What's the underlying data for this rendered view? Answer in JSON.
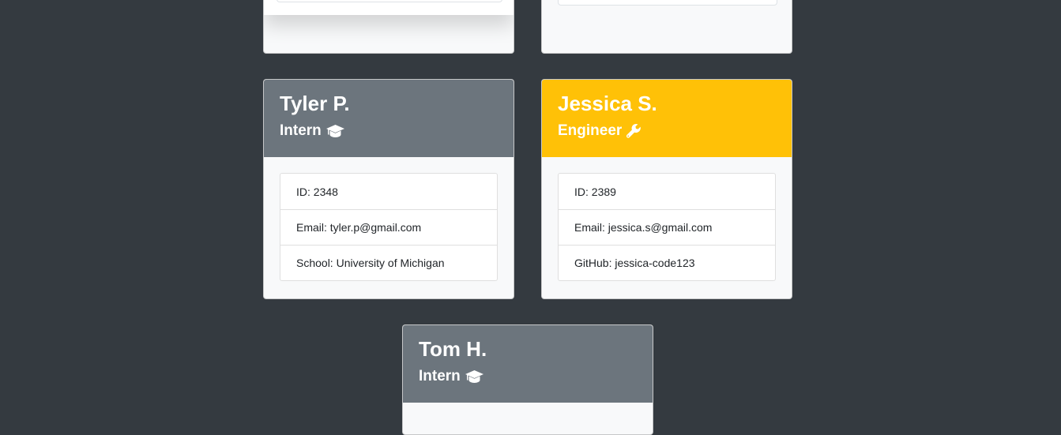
{
  "team": {
    "cards": [
      {
        "name": "Tyler P.",
        "role": "Intern",
        "role_icon": "graduation-cap-icon",
        "fields": [
          "ID: 2348",
          "Email: tyler.p@gmail.com",
          "School: University of Michigan"
        ]
      },
      {
        "name": "Jessica S.",
        "role": "Engineer",
        "role_icon": "wrench-icon",
        "fields": [
          "ID: 2389",
          "Email: jessica.s@gmail.com",
          "GitHub: jessica-code123"
        ]
      },
      {
        "name": "Tom H.",
        "role": "Intern",
        "role_icon": "graduation-cap-icon"
      }
    ]
  },
  "colors": {
    "background": "#343a40",
    "intern_header": "#6c757d",
    "engineer_header": "#ffc107",
    "card_body": "#f8f9fa"
  }
}
